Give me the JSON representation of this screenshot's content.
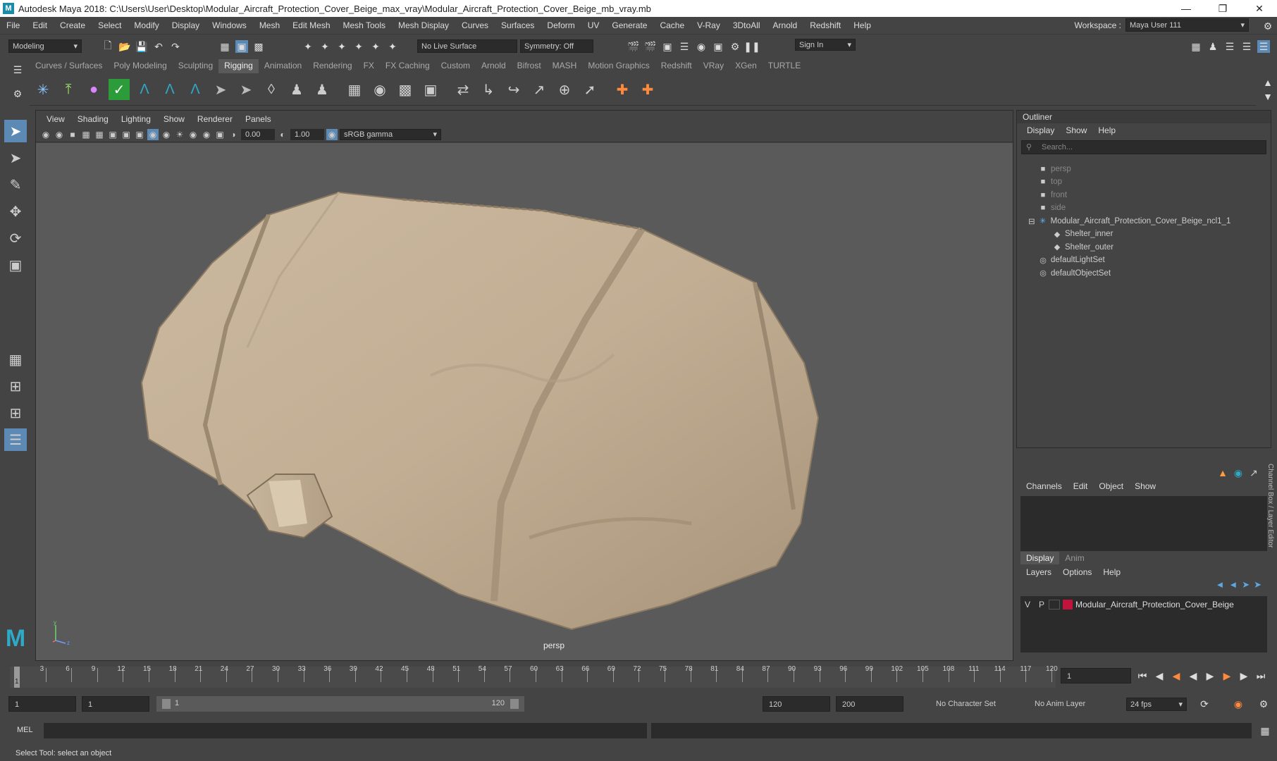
{
  "window": {
    "title": "Autodesk Maya 2018: C:\\Users\\User\\Desktop\\Modular_Aircraft_Protection_Cover_Beige_max_vray\\Modular_Aircraft_Protection_Cover_Beige_mb_vray.mb"
  },
  "menu": [
    "File",
    "Edit",
    "Create",
    "Select",
    "Modify",
    "Display",
    "Windows",
    "Mesh",
    "Edit Mesh",
    "Mesh Tools",
    "Mesh Display",
    "Curves",
    "Surfaces",
    "Deform",
    "UV",
    "Generate",
    "Cache",
    "V-Ray",
    "3DtoAll",
    "Arnold",
    "Redshift",
    "Help"
  ],
  "workspace": {
    "label": "Workspace :",
    "value": "Maya User 111"
  },
  "status": {
    "mode": "Modeling",
    "live_surface": "No Live Surface",
    "symmetry": "Symmetry: Off",
    "sign_in": "Sign In"
  },
  "shelf_tabs": [
    "Curves / Surfaces",
    "Poly Modeling",
    "Sculpting",
    "Rigging",
    "Animation",
    "Rendering",
    "FX",
    "FX Caching",
    "Custom",
    "Arnold",
    "Bifrost",
    "MASH",
    "Motion Graphics",
    "Redshift",
    "VRay",
    "XGen",
    "TURTLE"
  ],
  "active_shelf": "Rigging",
  "panel": {
    "menu": [
      "View",
      "Shading",
      "Lighting",
      "Show",
      "Renderer",
      "Panels"
    ],
    "exposure": "0.00",
    "gamma": "1.00",
    "color_space": "sRGB gamma",
    "camera": "persp"
  },
  "outliner": {
    "title": "Outliner",
    "menu": [
      "Display",
      "Show",
      "Help"
    ],
    "search_placeholder": "Search...",
    "items": [
      {
        "label": "persp",
        "icon": "camera-icon",
        "dim": true
      },
      {
        "label": "top",
        "icon": "camera-icon",
        "dim": true
      },
      {
        "label": "front",
        "icon": "camera-icon",
        "dim": true
      },
      {
        "label": "side",
        "icon": "camera-icon",
        "dim": true
      },
      {
        "label": "Modular_Aircraft_Protection_Cover_Beige_ncl1_1",
        "icon": "group-icon",
        "dim": false
      },
      {
        "label": "Shelter_inner",
        "icon": "mesh-icon",
        "dim": false
      },
      {
        "label": "Shelter_outer",
        "icon": "mesh-icon",
        "dim": false
      },
      {
        "label": "defaultLightSet",
        "icon": "set-icon",
        "dim": false
      },
      {
        "label": "defaultObjectSet",
        "icon": "set-icon",
        "dim": false
      }
    ]
  },
  "channel_box": {
    "menu": [
      "Channels",
      "Edit",
      "Object",
      "Show"
    ],
    "side_label": "Channel Box / Layer Editor"
  },
  "layer_editor": {
    "tabs": [
      "Display",
      "Anim"
    ],
    "menu": [
      "Layers",
      "Options",
      "Help"
    ],
    "layer": {
      "v": "V",
      "p": "P",
      "name": "Modular_Aircraft_Protection_Cover_Beige",
      "color": "#c0143c"
    }
  },
  "timeline": {
    "ticks": [
      "3",
      "6",
      "9",
      "12",
      "15",
      "18",
      "21",
      "24",
      "27",
      "30",
      "33",
      "36",
      "39",
      "42",
      "45",
      "48",
      "51",
      "54",
      "57",
      "60",
      "63",
      "66",
      "69",
      "72",
      "75",
      "78",
      "81",
      "84",
      "87",
      "90",
      "93",
      "96",
      "99",
      "102",
      "105",
      "108",
      "111",
      "114",
      "117",
      "120"
    ],
    "current": "1",
    "current_field": "1"
  },
  "range": {
    "start": "1",
    "start2": "1",
    "slider_start": "1",
    "slider_end": "120",
    "end": "120",
    "end2": "200",
    "character_set": "No Character Set",
    "anim_layer": "No Anim Layer",
    "fps": "24 fps"
  },
  "command": {
    "label": "MEL"
  },
  "help_line": "Select Tool: select an object"
}
